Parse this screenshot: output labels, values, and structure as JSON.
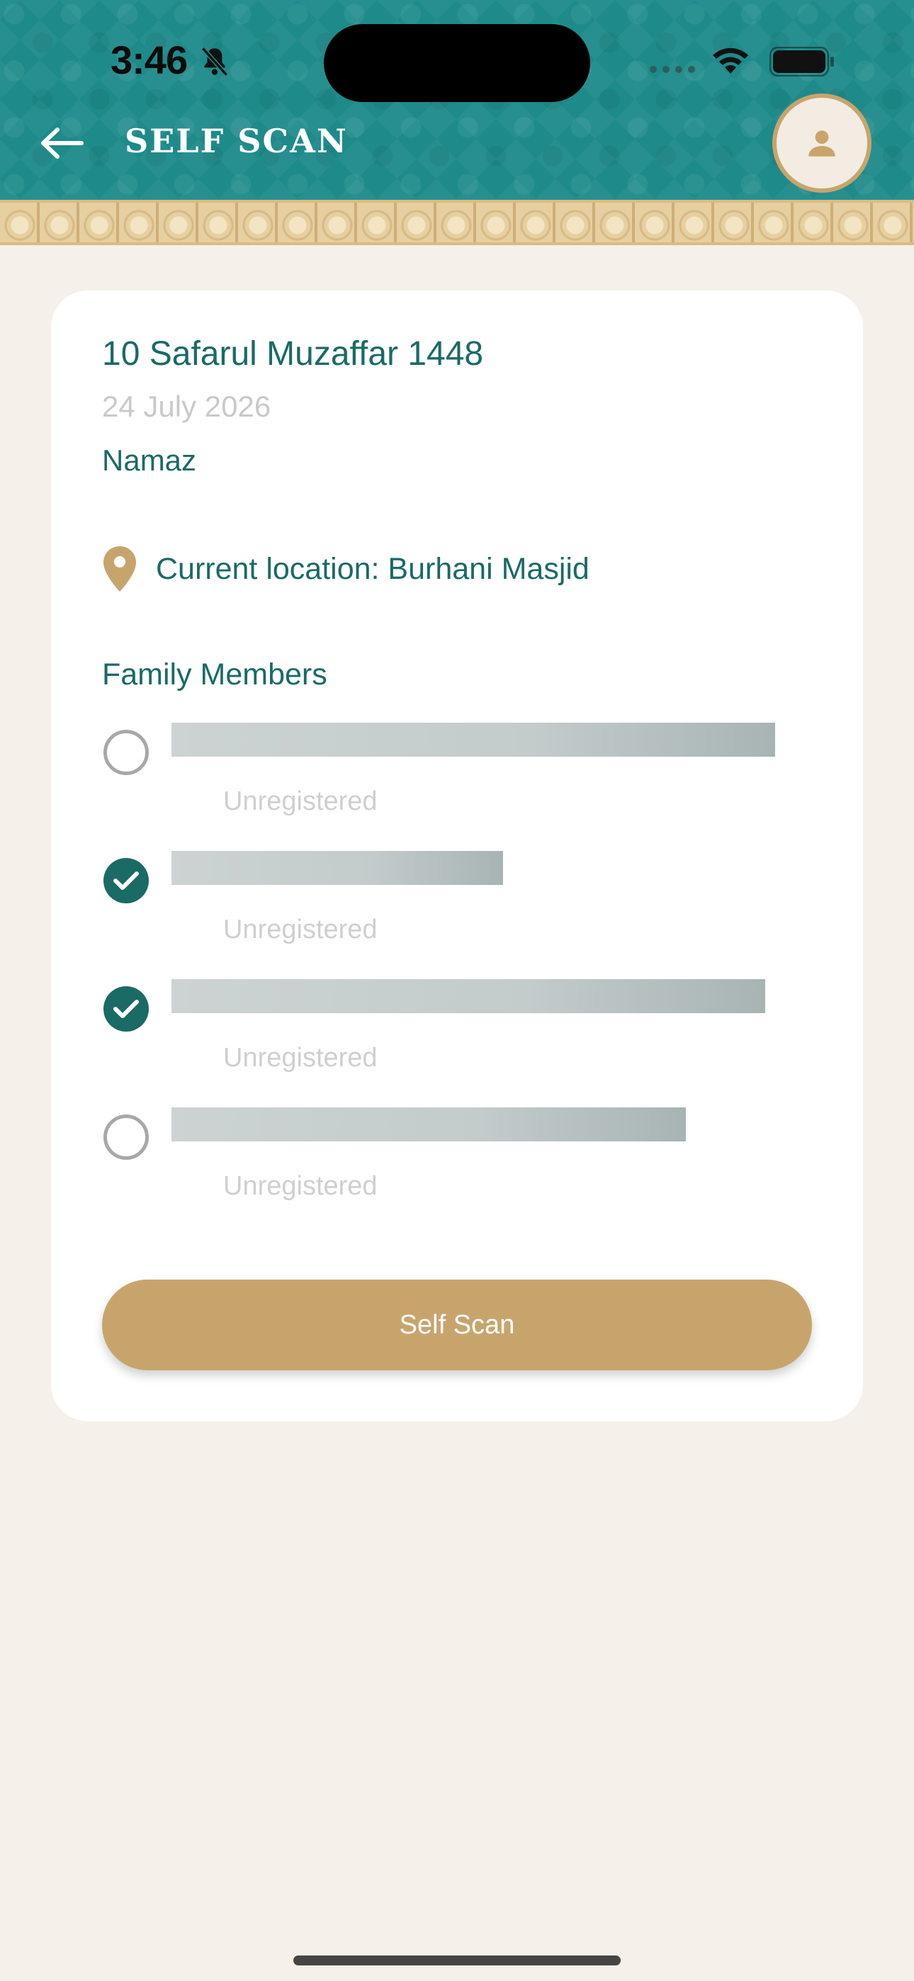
{
  "status_bar": {
    "time": "3:46"
  },
  "header": {
    "title": "SELF SCAN",
    "back_icon": "arrow-left-icon",
    "avatar_icon": "person-icon"
  },
  "card": {
    "hijri_date": "10 Safarul Muzaffar 1448",
    "gregorian_date": "24 July 2026",
    "event": "Namaz",
    "location": "Current location: Burhani Masjid",
    "family_title": "Family Members",
    "members": [
      {
        "status": "Unregistered",
        "checked": false
      },
      {
        "status": "Unregistered",
        "checked": true
      },
      {
        "status": "Unregistered",
        "checked": true
      },
      {
        "status": "Unregistered",
        "checked": false
      }
    ],
    "button_label": "Self Scan"
  },
  "colors": {
    "header_teal": "#1e8a8a",
    "primary_text": "#1a6a66",
    "accent_gold": "#c8a46d",
    "background": "#f5f0e9"
  }
}
